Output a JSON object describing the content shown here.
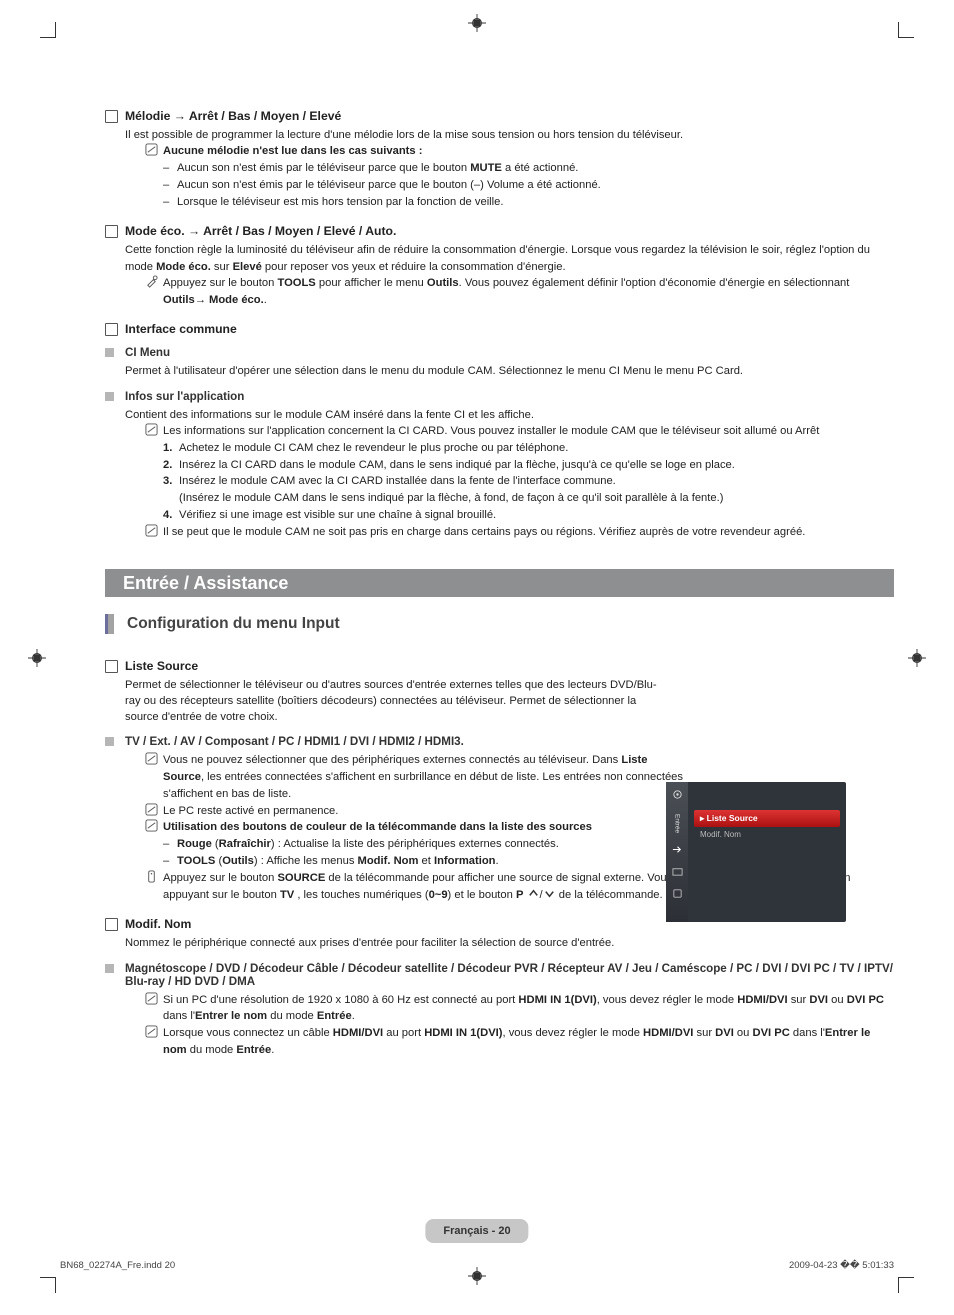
{
  "sections": {
    "melody": {
      "title": "Mélodie → Arrêt / Bas / Moyen / Elevé",
      "desc": "Il est possible de programmer la lecture d'une mélodie lors de la mise sous tension ou hors tension du téléviseur.",
      "note_title": "Aucune mélodie n'est lue dans les cas suivants :",
      "d1_a": "Aucun son n'est émis par le téléviseur parce que le bouton ",
      "d1_b": "MUTE",
      "d1_c": " a été actionné.",
      "d2": "Aucun son n'est émis par le téléviseur parce que le bouton (–) Volume a été actionné.",
      "d3": "Lorsque le téléviseur est mis hors tension par la fonction de veille."
    },
    "eco": {
      "title": "Mode éco. → Arrêt / Bas / Moyen / Elevé / Auto.",
      "p1_a": "Cette fonction règle la luminosité du téléviseur afin de réduire la consommation d'énergie. Lorsque vous regardez la télévision le soir, réglez l'option du mode ",
      "p1_b": "Mode éco.",
      "p1_c": " sur ",
      "p1_d": "Elevé",
      "p1_e": " pour reposer vos yeux et réduire la consommation d'énergie.",
      "p2_a": "Appuyez sur le bouton ",
      "p2_b": "TOOLS",
      "p2_c": " pour afficher le menu ",
      "p2_d": "Outils",
      "p2_e": ". Vous pouvez également définir l'option d'économie d'énergie en sélectionnant ",
      "p2_f": "Outils",
      "p2_g": "→ ",
      "p2_h": "Mode éco.",
      "p2_i": "."
    },
    "ci": {
      "title": "Interface commune",
      "menu_title": "CI Menu",
      "menu_desc": "Permet à l'utilisateur d'opérer une sélection dans le menu du module CAM. Sélectionnez le menu CI Menu le menu PC Card.",
      "app_title": "Infos sur l'application",
      "app_desc": "Contient des informations sur le module CAM inséré dans la fente CI et les affiche.",
      "app_note": "Les informations sur l'application concernent la CI CARD. Vous pouvez installer le module CAM que le téléviseur soit allumé ou Arrêt",
      "s1": "Achetez le module CI CAM chez le revendeur le plus proche ou par téléphone.",
      "s2": "Insérez la CI CARD dans le module CAM, dans le sens indiqué par la flèche, jusqu'à ce qu'elle se loge en place.",
      "s3": "Insérez le module CAM avec la CI CARD installée dans la fente de l'interface commune.",
      "s3b": "(Insérez le module CAM dans le sens indiqué par la flèche, à fond, de façon à ce qu'il soit parallèle à la fente.)",
      "s4": "Vérifiez si une image est visible sur une chaîne à signal brouillé.",
      "app_note2": "Il se peut que le module CAM ne soit pas pris en charge dans certains pays ou régions. Vérifiez auprès de votre revendeur agréé."
    },
    "band_title": "Entrée / Assistance",
    "input_heading": "Configuration du menu Input",
    "source": {
      "title": "Liste Source",
      "desc": "Permet de sélectionner le téléviseur ou d'autres sources d'entrée externes telles que des lecteurs DVD/Blu-ray ou des récepteurs satellite (boîtiers décodeurs) connectées au téléviseur. Permet de sélectionner la source d'entrée de votre choix.",
      "sub_title": "TV / Ext. / AV / Composant / PC / HDMI1 / DVI / HDMI2 / HDMI3.",
      "n1_a": "Vous ne pouvez sélectionner que des périphériques externes connectés au téléviseur. Dans ",
      "n1_b": "Liste Source",
      "n1_c": ", les entrées connectées s'affichent en surbrillance en début de liste. Les entrées non connectées s'affichent en bas de liste.",
      "n2": "Le PC reste activé en permanence.",
      "n3_title": "Utilisation des boutons de couleur de la télécommande dans la liste des sources",
      "n3_r_a": "Rouge",
      "n3_r_b": " (",
      "n3_r_c": "Rafraîchir",
      "n3_r_d": ") : Actualise la liste des périphériques externes connectés.",
      "n3_t_a": "TOOLS",
      "n3_t_b": " (",
      "n3_t_c": "Outils",
      "n3_t_d": ") : Affiche les menus ",
      "n3_t_e": "Modif. Nom",
      "n3_t_f": " et ",
      "n3_t_g": "Information",
      "n3_t_h": ".",
      "n4_a": "Appuyez sur le bouton ",
      "n4_b": "SOURCE",
      "n4_c": " de la télécommande pour afficher une source de signal externe. Vous pouvez sélectionner le mode TV en appuyant sur le bouton ",
      "n4_d": "TV",
      "n4_e": " , les touches numériques (",
      "n4_f": "0~9",
      "n4_g": ") et le bouton ",
      "n4_h": "P",
      "n4_i": "  de la télécommande."
    },
    "modif": {
      "title": "Modif. Nom",
      "desc": "Nommez le périphérique connecté aux prises d'entrée pour faciliter la sélection de source d'entrée.",
      "sub_title": "Magnétoscope / DVD / Décodeur Câble / Décodeur satellite / Décodeur PVR / Récepteur AV / Jeu / Caméscope / PC / DVI / DVI PC / TV / IPTV/ Blu-ray / HD DVD / DMA",
      "n1_a": "Si un PC d'une résolution de 1920 x 1080 à 60 Hz est connecté au port ",
      "n1_b": "HDMI IN 1(DVI)",
      "n1_c": ", vous devez régler le mode ",
      "n1_d": "HDMI/DVI",
      "n1_e": " sur ",
      "n1_f": "DVI",
      "n1_g": " ou ",
      "n1_h": "DVI PC",
      "n1_i": " dans l'",
      "n1_j": "Entrer le nom",
      "n1_k": " du mode ",
      "n1_l": "Entrée",
      "n1_m": ".",
      "n2_a": "Lorsque vous connectez un câble ",
      "n2_b": "HDMI/DVI",
      "n2_c": " au port ",
      "n2_d": "HDMI IN 1(DVI)",
      "n2_e": ", vous devez régler le mode ",
      "n2_f": "HDMI/DVI",
      "n2_g": " sur ",
      "n2_h": "DVI",
      "n2_i": " ou ",
      "n2_j": "DVI PC",
      "n2_k": " dans l'",
      "n2_l": "Entrer le nom",
      "n2_m": " du mode ",
      "n2_n": "Entrée",
      "n2_o": "."
    }
  },
  "osd": {
    "side_text": "Entrée",
    "selected": "Liste Source",
    "item2": "Modif. Nom"
  },
  "footer": "Français - 20",
  "indd_left": "BN68_02274A_Fre.indd   20",
  "indd_right": "2009-04-23   �� 5:01:33"
}
